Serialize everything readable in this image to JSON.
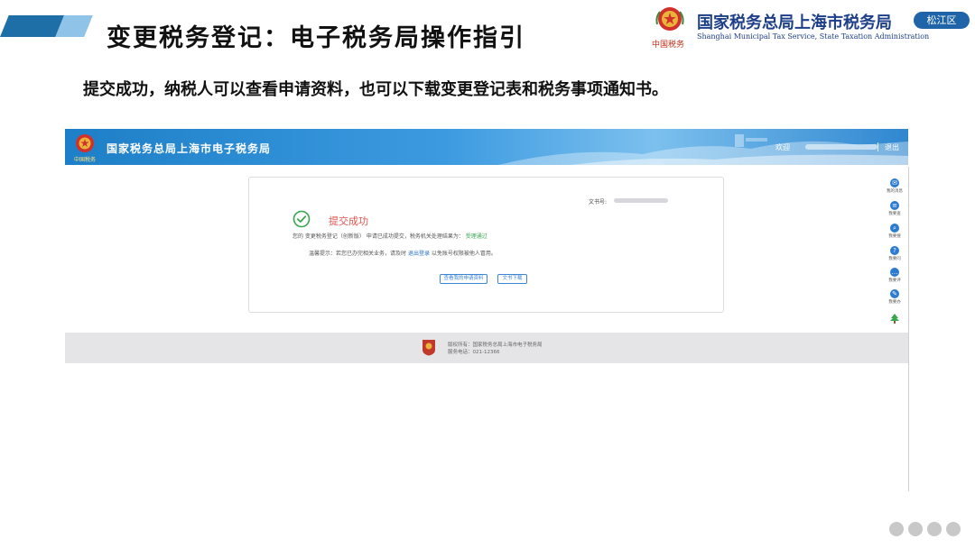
{
  "slide": {
    "title": "变更税务登记：电子税务局操作指引",
    "instruction": "提交成功，纳税人可以查看申请资料，也可以下载变更登记表和税务事项通知书。",
    "accent_color": "#1e6fa8"
  },
  "branding": {
    "emblem_caption": "中国税务",
    "org_name_cn": "国家税务总局上海市税务局",
    "org_name_en": "Shanghai Municipal Tax Service, State Taxation Administration",
    "district_badge": "松江区"
  },
  "portal": {
    "header": {
      "emblem_caption": "中国税务",
      "title": "国家税务总局上海市电子税务局",
      "welcome_label": "欢迎",
      "logout_label": "退出"
    },
    "result_card": {
      "doc_number_label": "文书号:",
      "status_title": "提交成功",
      "message_prefix": "您的 变更税务登记（创新版） 申请已成功提交，税务机关处理结果为：",
      "message_result": "受理通过",
      "tip_prefix": "温馨提示：若您已办完相关业务，请及时",
      "tip_link": "退出登录",
      "tip_suffix": "以免账号权限被他人冒用。",
      "view_button": "查看我的申请资料",
      "download_button": "文书下载",
      "success_color": "#3aa64f",
      "error_text_color": "#e0554f"
    },
    "side_toolbar": [
      {
        "label": "我的消息",
        "icon": "message-icon"
      },
      {
        "label": "我要查",
        "icon": "query-icon"
      },
      {
        "label": "我要搜",
        "icon": "search-icon"
      },
      {
        "label": "我要问",
        "icon": "question-icon"
      },
      {
        "label": "我要评",
        "icon": "comment-icon"
      },
      {
        "label": "我要办",
        "icon": "edit-icon"
      },
      {
        "label": "",
        "icon": "tree-icon"
      }
    ],
    "footer": {
      "copyright": "版权所有：国家税务总局上海市电子税务局",
      "service_phone": "服务电话：021-12366"
    }
  }
}
